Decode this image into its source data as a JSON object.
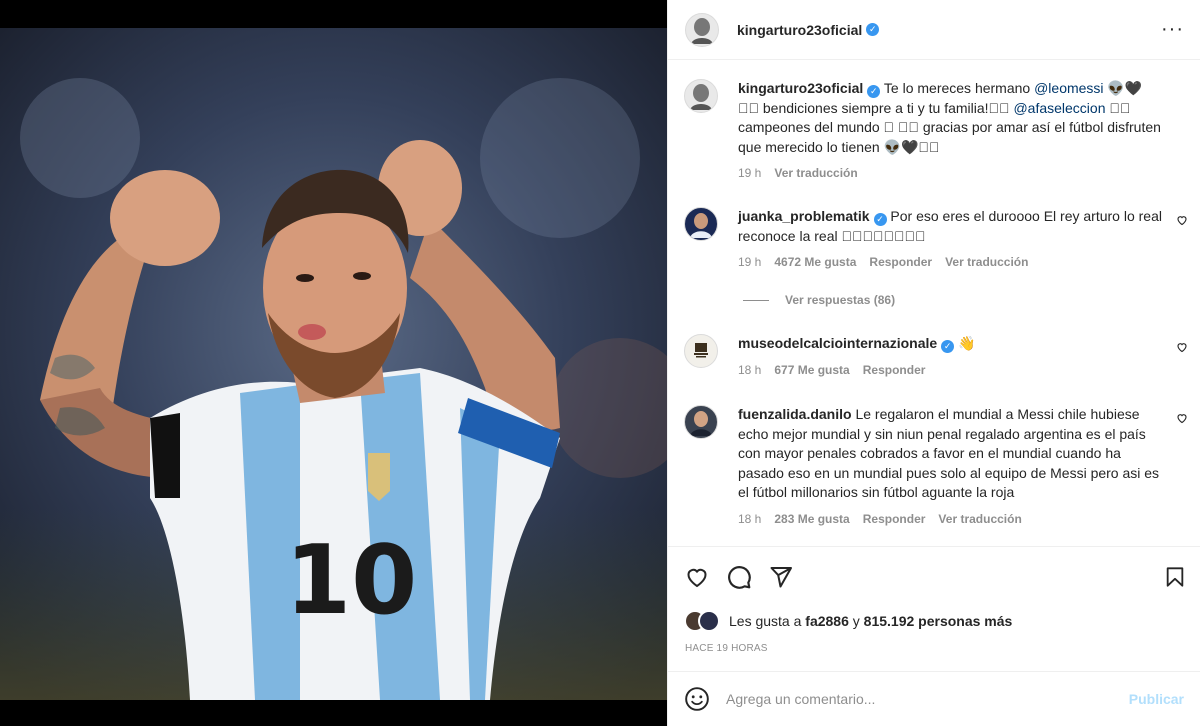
{
  "post": {
    "author": "kingarturo23oficial",
    "verified": true,
    "menu_icon": "more-horizontal-icon"
  },
  "photo": {
    "description_icon": "player-celebration-image",
    "jersey_number": "10"
  },
  "comments": [
    {
      "user": "kingarturo23oficial",
      "verified": true,
      "text_before": "Te lo mereces hermano ",
      "mention1": "@leomessi",
      "text_middle": " 👽🖤 ￿￿ bendiciones siempre a ti y tu familia!￿￿ ",
      "mention2": "@afaseleccion",
      "text_after": " ￿￿ campeones del mundo ￿ ￿￿ gracias por amar así el fútbol disfruten que merecido lo tienen 👽🖤￿￿",
      "time": "19 h",
      "translate": "Ver traducción"
    },
    {
      "user": "juanka_problematik",
      "verified": true,
      "text": "Por eso eres el duroooo El rey arturo lo real reconoce la real ￿￿￿￿￿￿￿￿",
      "time": "19 h",
      "likes": "4672 Me gusta",
      "reply": "Responder",
      "translate": "Ver traducción",
      "replies": "Ver respuestas (86)"
    },
    {
      "user": "museodelcalciointernazionale",
      "verified": true,
      "text": "👋",
      "time": "18 h",
      "likes": "677 Me gusta",
      "reply": "Responder"
    },
    {
      "user": "fuenzalida.danilo",
      "verified": false,
      "text": "Le regalaron el mundial a Messi chile hubiese echo mejor mundial y sin niun penal regalado argentina es el país con mayor penales cobrados a favor en el mundial cuando ha pasado eso en un mundial pues solo al equipo de Messi pero asi es el fútbol millonarios sin fútbol aguante la roja",
      "time": "18 h",
      "likes": "283 Me gusta",
      "reply": "Responder",
      "translate": "Ver traducción"
    }
  ],
  "likes": {
    "prefix": "Les gusta a ",
    "user": "fa2886",
    "middle": " y ",
    "others": "815.192 personas más"
  },
  "time_ago": "HACE 19 HORAS",
  "add_comment": {
    "placeholder": "Agrega un comentario...",
    "publish": "Publicar"
  },
  "colors": {
    "verified": "#3897f0",
    "mention": "#00376b",
    "muted": "#8e8e8e",
    "publish_disabled": "#b2dffc"
  }
}
